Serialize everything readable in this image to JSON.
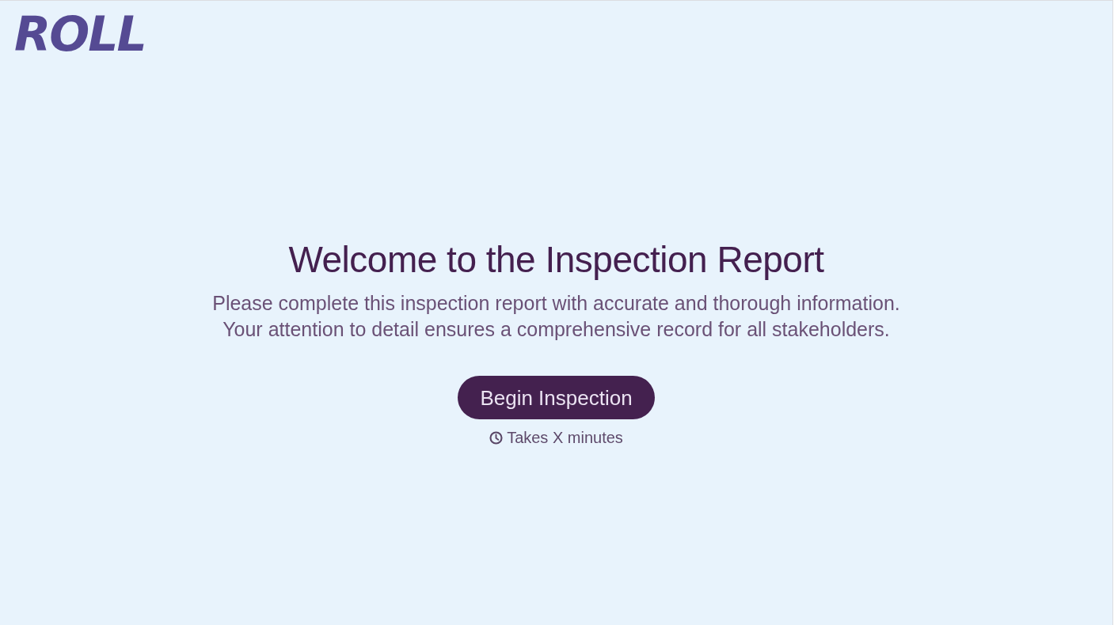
{
  "logo": {
    "text": "ROLL"
  },
  "heading": "Welcome to the Inspection Report",
  "intro": [
    "Please complete this inspection report with accurate and thorough information.",
    "Your attention to detail ensures a comprehensive record for all stakeholders."
  ],
  "start_button": {
    "label": "Begin Inspection"
  },
  "duration": {
    "text": "Takes X minutes"
  }
}
